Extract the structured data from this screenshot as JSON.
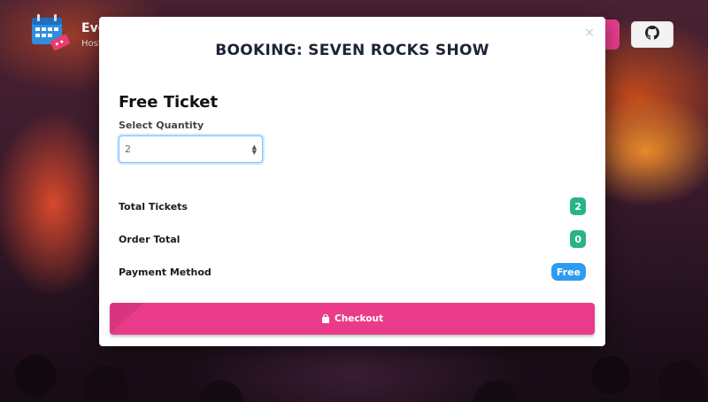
{
  "brand": {
    "title": "Eve",
    "subtitle": "Host"
  },
  "modal": {
    "close_label": "×",
    "title": "BOOKING: SEVEN ROCKS SHOW",
    "ticket_name": "Free Ticket",
    "quantity_label": "Select Quantity",
    "quantity_value": "2",
    "rows": {
      "total_tickets": {
        "label": "Total Tickets",
        "value": "2"
      },
      "order_total": {
        "label": "Order Total",
        "value": "0"
      },
      "payment_method": {
        "label": "Payment Method",
        "value": "Free"
      }
    },
    "checkout_label": "Checkout"
  },
  "icons": {
    "brand_logo": "calendar-ticket-icon",
    "github": "github-icon",
    "checkout": "bag-icon",
    "select_arrows": "updown-arrows-icon"
  },
  "colors": {
    "accent_pink": "#ea3b8a",
    "badge_green": "#28b38a",
    "badge_blue": "#2d9cf0",
    "focus_blue": "#80bdff",
    "title_dark": "#1b2536"
  }
}
